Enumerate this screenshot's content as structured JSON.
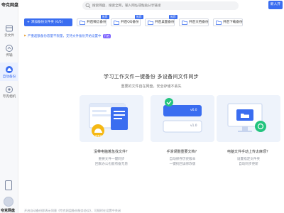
{
  "app": {
    "logo_text": "夸克网盘",
    "bottom_label": "夸克网盘"
  },
  "sidebar": {
    "items": [
      {
        "label": "云文件",
        "icon": "cloud-icon"
      },
      {
        "label": "传输",
        "icon": "transfer-icon"
      },
      {
        "label": "自动备份",
        "icon": "backup-icon",
        "active": true
      },
      {
        "label": "夸克相机",
        "icon": "camera-icon"
      }
    ]
  },
  "topbar": {
    "search_placeholder": "搜索网盘、搜索全网，输入网址或粘贴分享链接",
    "new_user_button": "新人开"
  },
  "actions": {
    "add_button": "添加备份文件夹 (0/5)",
    "features": [
      {
        "label": "开启微信备份",
        "tag": "推荐"
      },
      {
        "label": "开启QQ备份",
        "tag": "推荐"
      },
      {
        "label": "开启桌面备份",
        "tag": "推荐"
      },
      {
        "label": "开启文档备份",
        "tag": ""
      },
      {
        "label": "开启下载备份",
        "tag": ""
      }
    ]
  },
  "notice": {
    "text": "严重超额备份容量不限量，支持文件备份开始设置中",
    "badge": "开启"
  },
  "hero": {
    "title": "学习工作文件一键备份 多设备间文件同步",
    "subtitle": "重要的文件自在网盘，安全存储不丢失"
  },
  "cards": [
    {
      "title": "没带电脑着急找文件？",
      "desc_line1": "重要文件一键同步",
      "desc_line2": "回家办公也能有备无患",
      "badge": "云盘备份"
    },
    {
      "title": "手滑误删重要文档？",
      "desc_line1": "自动保存历史版本",
      "desc_line2": "一键找回误修改版",
      "version_top": "v6.0",
      "version_bottom": "v1.0"
    },
    {
      "title": "电脑文件手动上传太麻烦？",
      "desc_line1": "设置指定文件夹",
      "desc_line2": "自动同步更新"
    }
  ],
  "footer_text": "开启自动备份即表示同意《夸克网盘备份服务协议》，可随时在设置中关闭",
  "colors": {
    "accent": "#3a6df0",
    "purple": "#7b61ff",
    "warn": "#e8a23a"
  }
}
